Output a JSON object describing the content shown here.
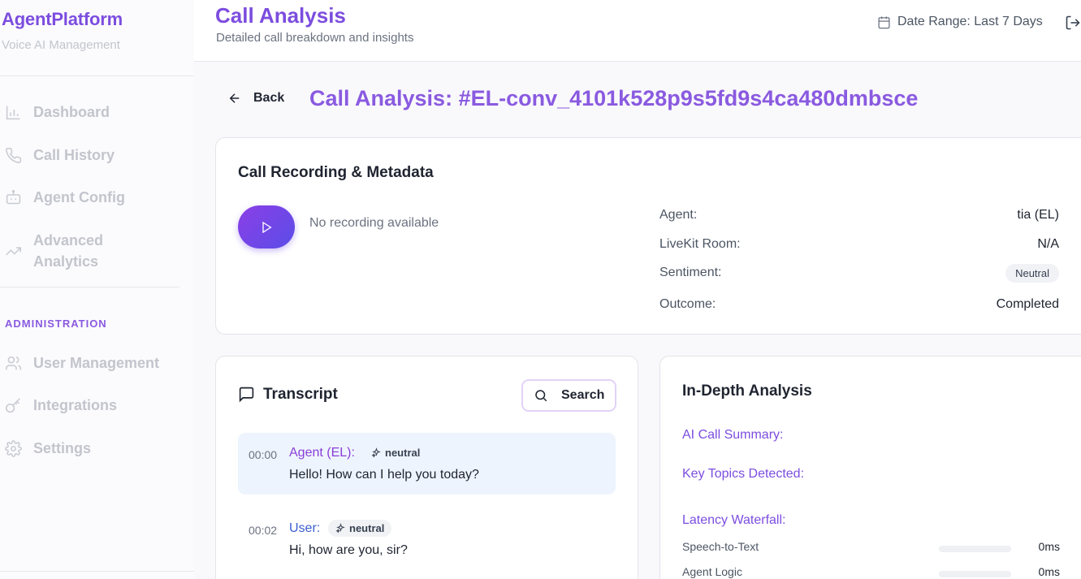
{
  "sidebar": {
    "brand": "AgentPlatform",
    "brand_sub": "Voice AI Management",
    "nav": [
      {
        "label": "Dashboard",
        "icon": "bar-chart-icon"
      },
      {
        "label": "Call History",
        "icon": "phone-icon"
      },
      {
        "label": "Agent Config",
        "icon": "bot-icon"
      },
      {
        "label": "Advanced Analytics",
        "icon": "trending-up-icon"
      }
    ],
    "admin_label": "ADMINISTRATION",
    "admin_nav": [
      {
        "label": "User Management",
        "icon": "users-icon"
      },
      {
        "label": "Integrations",
        "icon": "key-icon"
      },
      {
        "label": "Settings",
        "icon": "gear-icon"
      }
    ]
  },
  "header": {
    "title": "Call Analysis",
    "subtitle": "Detailed call breakdown and insights",
    "date_range": "Date Range: Last 7 Days"
  },
  "page": {
    "back_label": "Back",
    "call_title": "Call Analysis: #EL-conv_4101k528p9s5fd9s4ca480dmbsce"
  },
  "recording": {
    "title": "Call Recording & Metadata",
    "no_recording": "No recording available",
    "meta": {
      "agent_label": "Agent:",
      "agent_value": "tia (EL)",
      "room_label": "LiveKit Room:",
      "room_value": "N/A",
      "sentiment_label": "Sentiment:",
      "sentiment_value": "Neutral",
      "outcome_label": "Outcome:",
      "outcome_value": "Completed"
    }
  },
  "transcript": {
    "title": "Transcript",
    "search_label": "Search",
    "messages": [
      {
        "time": "00:00",
        "speaker": "Agent (EL):",
        "sentiment": "neutral",
        "text": "Hello! How can I help you today?"
      },
      {
        "time": "00:02",
        "speaker": "User:",
        "sentiment": "neutral",
        "text": "Hi, how are you, sir?"
      }
    ]
  },
  "analysis": {
    "title": "In-Depth Analysis",
    "summary_label": "AI Call Summary:",
    "topics_label": "Key Topics Detected:",
    "latency_label": "Latency Waterfall:",
    "latency": [
      {
        "name": "Speech-to-Text",
        "value": "0ms",
        "fill": 0
      },
      {
        "name": "Agent Logic",
        "value": "0ms",
        "fill": 0
      }
    ]
  },
  "colors": {
    "accent": "#7c4ddf",
    "agent_bubble": "#eef4fd"
  }
}
